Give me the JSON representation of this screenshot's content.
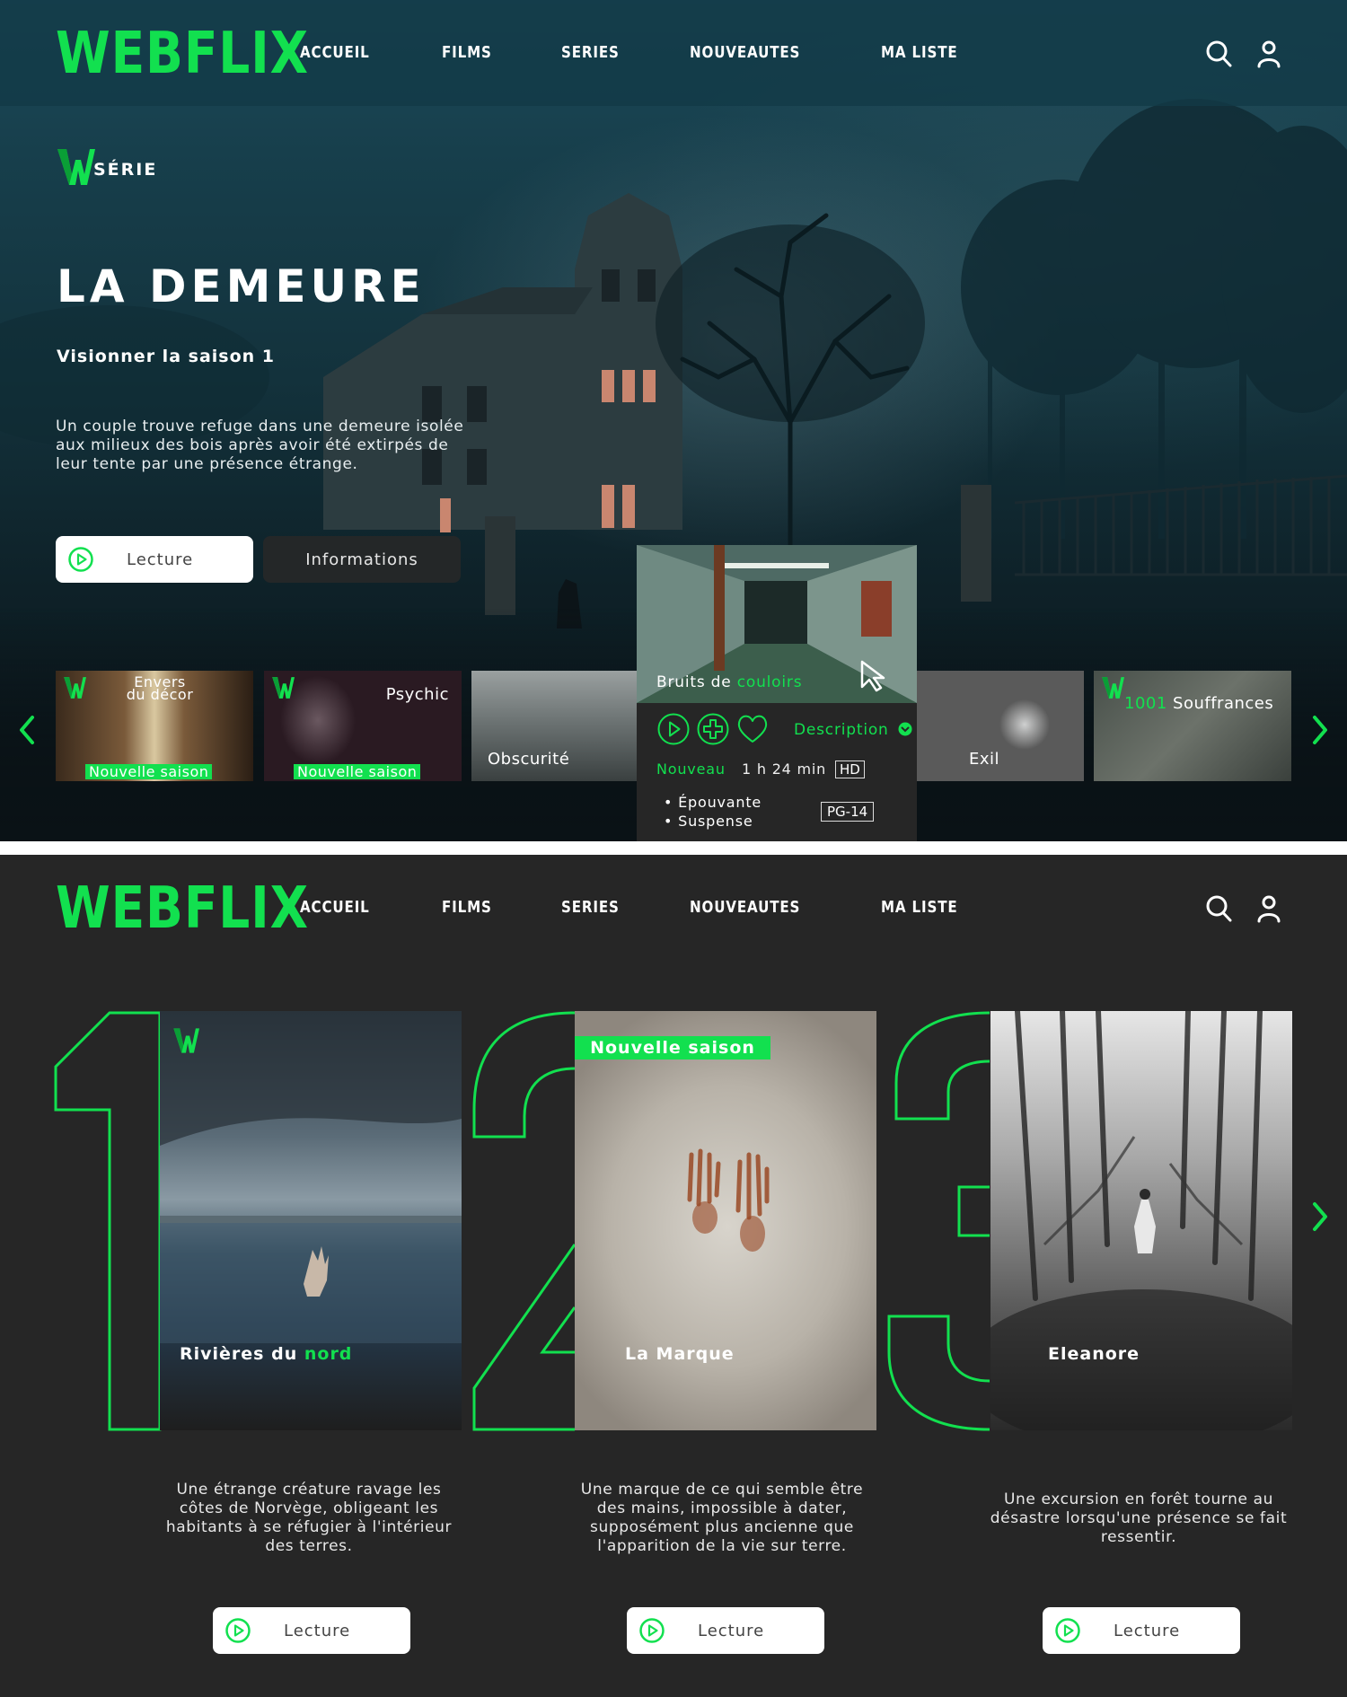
{
  "brand": {
    "name": "WEBFLIX",
    "accent": "#12e04f",
    "dark_bg": "#262626"
  },
  "nav": {
    "items": [
      "ACCUEIL",
      "FILMS",
      "SERIES",
      "NOUVEAUTES",
      "MA LISTE"
    ],
    "icons": [
      "search-icon",
      "user-icon"
    ]
  },
  "hero": {
    "badge": "SÉRIE",
    "title": "LA DEMEURE",
    "season": "Visionner la saison 1",
    "description": "Un couple trouve refuge dans une demeure isolée aux milieux des bois après avoir été extirpés de leur tente par une présence étrange.",
    "play_label": "Lecture",
    "info_label": "Informations"
  },
  "carousel": {
    "items": [
      {
        "title": "Envers du décor",
        "tag": "Nouvelle saison"
      },
      {
        "title": "Psychic",
        "tag": "Nouvelle saison"
      },
      {
        "title": "Obscurité"
      },
      {
        "title_prefix": "Bruits de ",
        "title_highlight": "couloirs"
      },
      {
        "title": "Exil"
      },
      {
        "title_prefix": "1001",
        "title_rest": " Souffrances"
      }
    ],
    "expanded": {
      "description_label": "Description",
      "status": "Nouveau",
      "duration": "1 h 24 min",
      "quality": "HD",
      "genres": [
        "• Épouvante",
        "• Suspense"
      ],
      "rating": "PG-14"
    }
  },
  "top10": {
    "cards": [
      {
        "rank": "1",
        "title": "Rivières du ",
        "title_highlight": "nord",
        "description": "Une étrange créature ravage les côtes de Norvège, obligeant les habitants à se réfugier à l'intérieur des terres.",
        "play_label": "Lecture"
      },
      {
        "rank": "2",
        "title": "La Marque",
        "tag": "Nouvelle saison",
        "description": "Une marque de ce qui semble être des mains, impossible à dater, supposément plus ancienne que l'apparition de la vie sur terre.",
        "play_label": "Lecture"
      },
      {
        "rank": "3",
        "title": "Eleanore",
        "description": "Une excursion en forêt tourne au désastre lorsqu'une présence se fait ressentir.",
        "play_label": "Lecture"
      }
    ]
  }
}
